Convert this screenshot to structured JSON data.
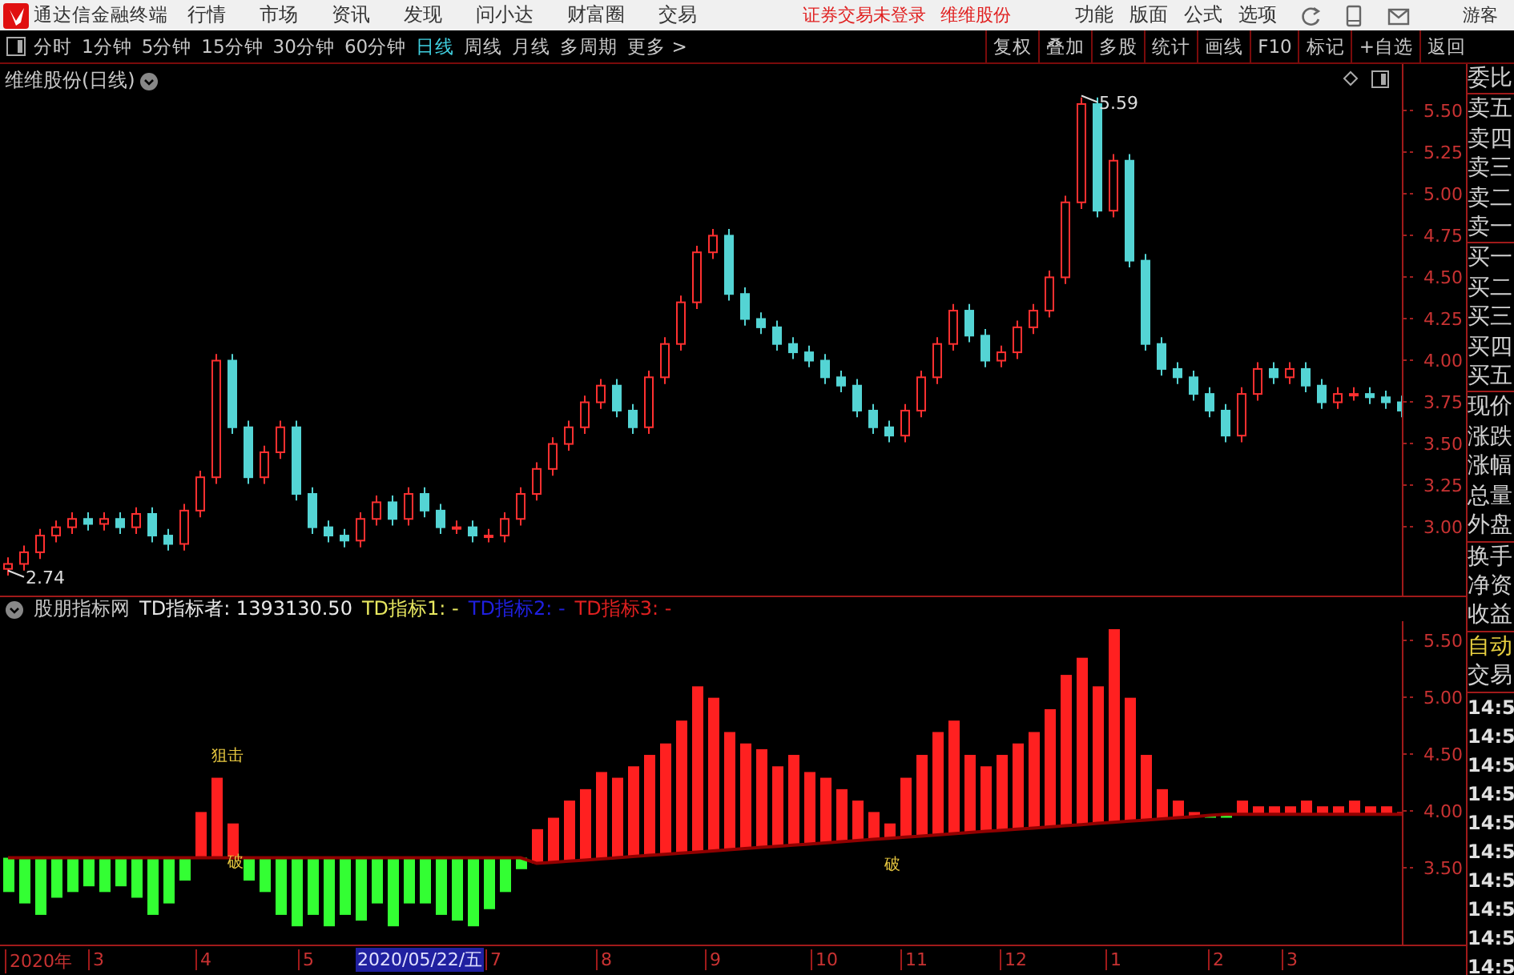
{
  "menu_bar": {
    "app_title": "通达信金融终端",
    "items": [
      "行情",
      "市场",
      "资讯",
      "发现",
      "问小达",
      "财富圈",
      "交易"
    ],
    "notices": [
      "证券交易未登录",
      "维维股份"
    ],
    "right_items": [
      "功能",
      "版面",
      "公式",
      "选项"
    ],
    "user": "游客"
  },
  "toolbar": {
    "periods": [
      {
        "label": "分时",
        "selected": false
      },
      {
        "label": "1分钟",
        "selected": false
      },
      {
        "label": "5分钟",
        "selected": false
      },
      {
        "label": "15分钟",
        "selected": false
      },
      {
        "label": "30分钟",
        "selected": false
      },
      {
        "label": "60分钟",
        "selected": false
      },
      {
        "label": "日线",
        "selected": true
      },
      {
        "label": "周线",
        "selected": false
      },
      {
        "label": "月线",
        "selected": false
      },
      {
        "label": "多周期",
        "selected": false
      },
      {
        "label": "更多 >",
        "selected": false
      }
    ],
    "actions": [
      "复权",
      "叠加",
      "多股",
      "统计",
      "画线",
      "F10",
      "标记",
      "+自选",
      "返回"
    ]
  },
  "price_panel": {
    "title": "维维股份(日线)",
    "high_label": "5.59",
    "low_label": "2.74",
    "axis_labels": [
      "5.50",
      "5.25",
      "5.00",
      "4.75",
      "4.50",
      "4.25",
      "4.00",
      "3.75",
      "3.50",
      "3.25",
      "3.00"
    ]
  },
  "indicator_panel": {
    "legend": [
      {
        "label": "股朋指标网",
        "color": "#c8c8c8"
      },
      {
        "label": "TD指标者: 1393130.50",
        "color": "#e8e8e8"
      },
      {
        "label": "TD指标1: -",
        "color": "#e8e860"
      },
      {
        "label": "TD指标2: -",
        "color": "#2020e0"
      },
      {
        "label": "TD指标3: -",
        "color": "#e02020"
      }
    ],
    "axis_labels": [
      "5.50",
      "5.00",
      "4.50",
      "4.00",
      "3.50"
    ],
    "signals": [
      "狙击",
      "破",
      "破"
    ],
    "time_labels": [
      {
        "label": "2020年",
        "selected": false
      },
      {
        "label": "3",
        "selected": false
      },
      {
        "label": "4",
        "selected": false
      },
      {
        "label": "5",
        "selected": false
      },
      {
        "label": "2020/05/22/五",
        "selected": true
      },
      {
        "label": "7",
        "selected": false
      },
      {
        "label": "8",
        "selected": false
      },
      {
        "label": "9",
        "selected": false
      },
      {
        "label": "10",
        "selected": false
      },
      {
        "label": "11",
        "selected": false
      },
      {
        "label": "12",
        "selected": false
      },
      {
        "label": "1",
        "selected": false
      },
      {
        "label": "2",
        "selected": false
      },
      {
        "label": "3",
        "selected": false
      }
    ]
  },
  "sidebar": {
    "groups": [
      [
        "委比"
      ],
      [
        "卖五",
        "卖四",
        "卖三",
        "卖二",
        "卖一"
      ],
      [
        "买一",
        "买二",
        "买三",
        "买四",
        "买五"
      ],
      [
        "现价",
        "涨跌",
        "涨幅",
        "总量",
        "外盘"
      ],
      [
        "换手",
        "净资",
        "收益"
      ]
    ],
    "trade": {
      "mode": "自动",
      "label": "交易",
      "times": [
        "14:5",
        "14:5",
        "14:5",
        "14:5",
        "14:5",
        "14:5",
        "14:5",
        "14:5",
        "14:5",
        "14:5"
      ]
    }
  }
}
